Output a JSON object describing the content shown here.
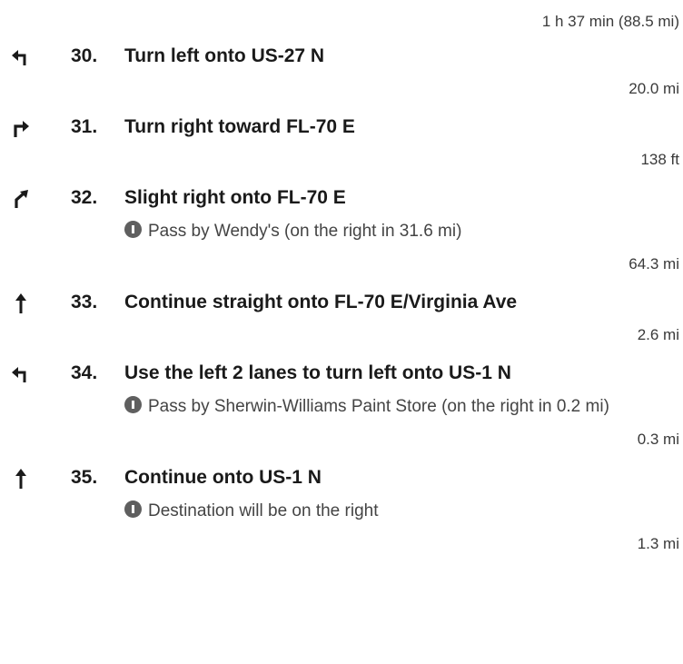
{
  "summary": {
    "total": "1 h 37 min (88.5 mi)"
  },
  "steps": [
    {
      "num": "30.",
      "text": "Turn left onto US-27 N",
      "icon": "turn-left-icon",
      "dist": "20.0 mi"
    },
    {
      "num": "31.",
      "text": "Turn right toward FL-70 E",
      "icon": "turn-right-icon",
      "dist": "138 ft"
    },
    {
      "num": "32.",
      "text": "Slight right onto FL-70 E",
      "icon": "slight-right-icon",
      "note": "Pass by Wendy's (on the right in 31.6 mi)",
      "dist": "64.3 mi"
    },
    {
      "num": "33.",
      "text": "Continue straight onto FL-70 E/Virginia Ave",
      "icon": "straight-icon",
      "dist": "2.6 mi"
    },
    {
      "num": "34.",
      "text": "Use the left 2 lanes to turn left onto US-1 N",
      "icon": "turn-left-icon",
      "note": "Pass by Sherwin-Williams Paint Store (on the right in 0.2 mi)",
      "dist": "0.3 mi"
    },
    {
      "num": "35.",
      "text": "Continue onto US-1 N",
      "icon": "straight-icon",
      "note": "Destination will be on the right",
      "dist": "1.3 mi"
    }
  ]
}
